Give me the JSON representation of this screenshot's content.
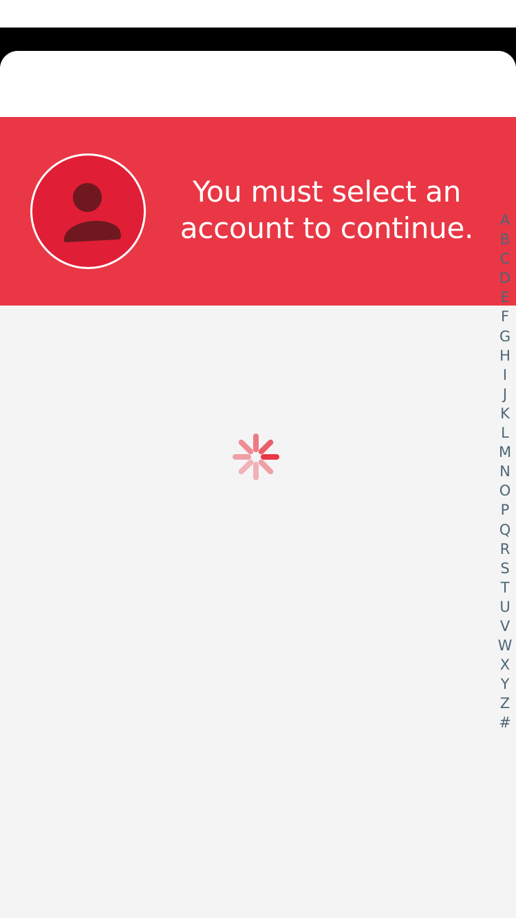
{
  "banner": {
    "message": "You must select an account to continue.",
    "avatar_icon": "person-icon",
    "background_color": "#e93745",
    "avatar_color": "#e01e36"
  },
  "loading": {
    "icon": "loading-spinner-icon",
    "color": "#e93745"
  },
  "alphabet_index": {
    "letters": [
      "A",
      "B",
      "C",
      "D",
      "E",
      "F",
      "G",
      "H",
      "I",
      "J",
      "K",
      "L",
      "M",
      "N",
      "O",
      "P",
      "Q",
      "R",
      "S",
      "T",
      "U",
      "V",
      "W",
      "X",
      "Y",
      "Z",
      "#"
    ],
    "color": "#4d6675"
  }
}
